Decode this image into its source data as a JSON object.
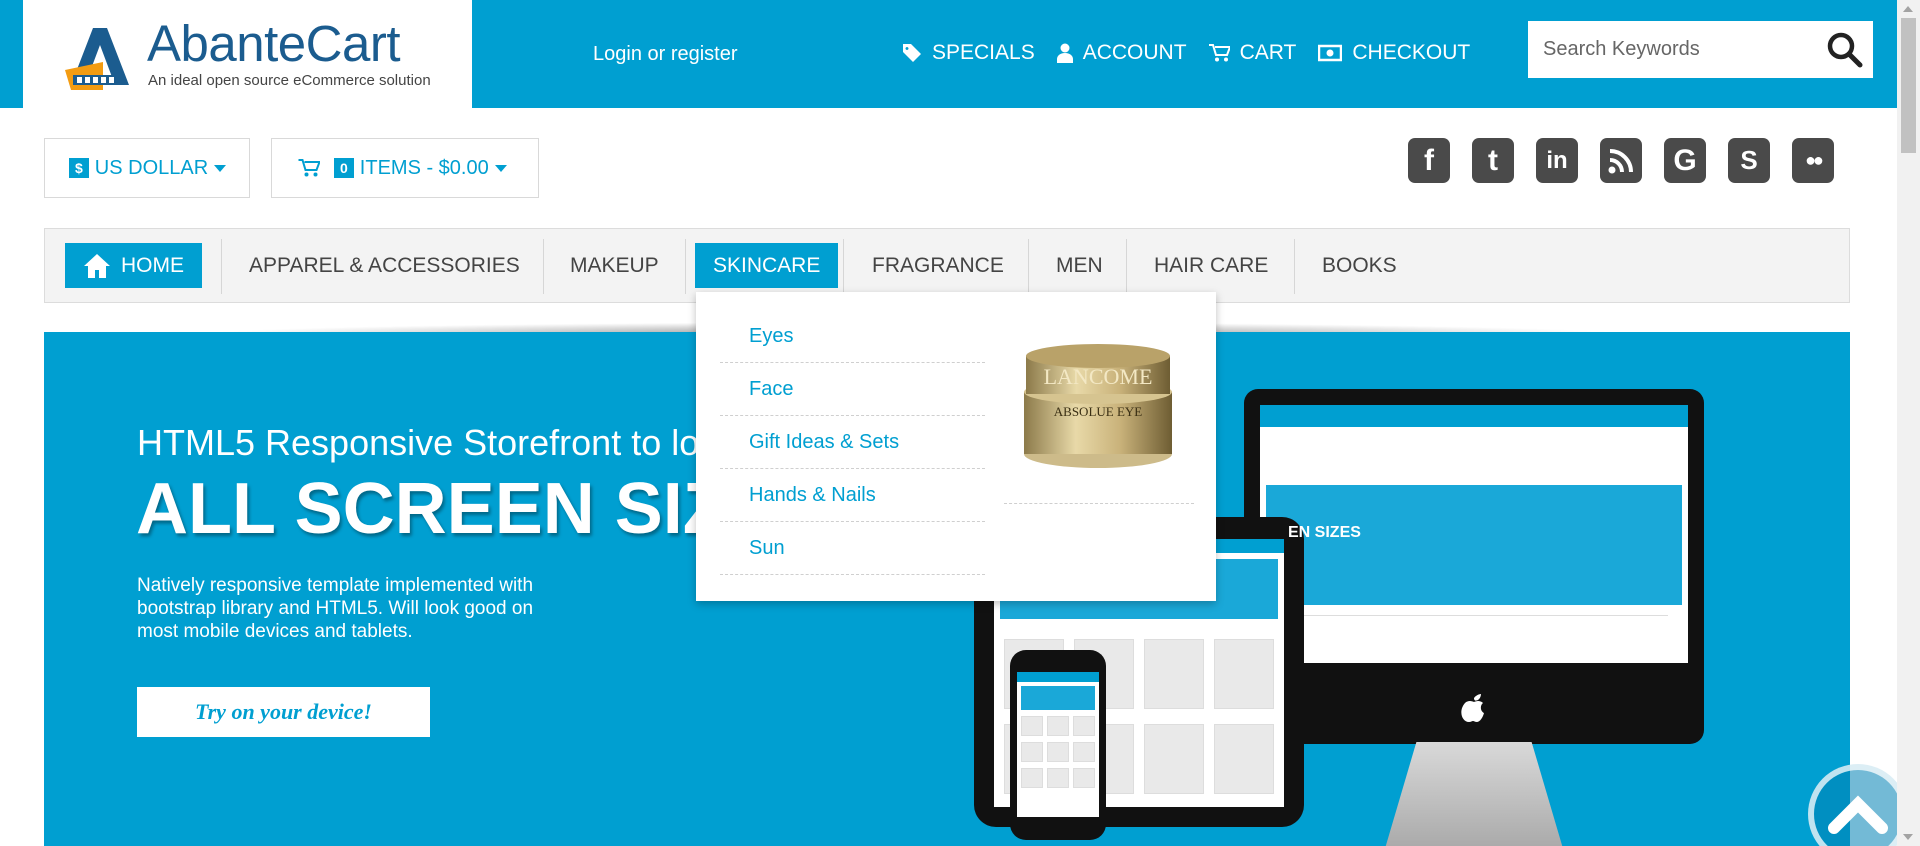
{
  "header": {
    "logo_text": "AbanteCart",
    "logo_tagline": "An ideal open source eCommerce solution",
    "login_label": "Login or register",
    "nav": [
      {
        "label": "SPECIALS",
        "icon": "tag-icon"
      },
      {
        "label": "ACCOUNT",
        "icon": "user-icon"
      },
      {
        "label": "CART",
        "icon": "cart-icon"
      },
      {
        "label": "CHECKOUT",
        "icon": "money-icon"
      }
    ],
    "search_placeholder": "Search Keywords"
  },
  "toolbar": {
    "currency_symbol": "$",
    "currency_label": "US DOLLAR",
    "cart_count": "0",
    "cart_label": "ITEMS - $0.00"
  },
  "social": [
    {
      "name": "facebook-icon",
      "glyph": "f"
    },
    {
      "name": "twitter-icon",
      "glyph": "t"
    },
    {
      "name": "linkedin-icon",
      "glyph": "in"
    },
    {
      "name": "rss-icon",
      "glyph": ""
    },
    {
      "name": "google-icon",
      "glyph": "G"
    },
    {
      "name": "skype-icon",
      "glyph": "S"
    },
    {
      "name": "flickr-icon",
      "glyph": "●●"
    }
  ],
  "categories": [
    {
      "label": "HOME",
      "active": false
    },
    {
      "label": "APPAREL & ACCESSORIES"
    },
    {
      "label": "MAKEUP"
    },
    {
      "label": "SKINCARE"
    },
    {
      "label": "FRAGRANCE"
    },
    {
      "label": "MEN"
    },
    {
      "label": "HAIR CARE"
    },
    {
      "label": "BOOKS"
    }
  ],
  "dropdown": {
    "items": [
      "Eyes",
      "Face",
      "Gift Ideas & Sets",
      "Hands & Nails",
      "Sun"
    ],
    "product_brand": "LANCOME",
    "product_name": "ABSOLUE EYE"
  },
  "banner": {
    "line1": "HTML5 Responsive Storefront to lo",
    "line2": "ALL SCREEN SIZ",
    "paragraph": "Natively responsive template implemented with bootstrap library and HTML5. Will look good on most mobile devices and tablets.",
    "button": "Try on your device!",
    "mock_text": "EN SIZES"
  },
  "colors": {
    "brand": "#009fd1",
    "nav_bg": "#f3f3f3"
  }
}
